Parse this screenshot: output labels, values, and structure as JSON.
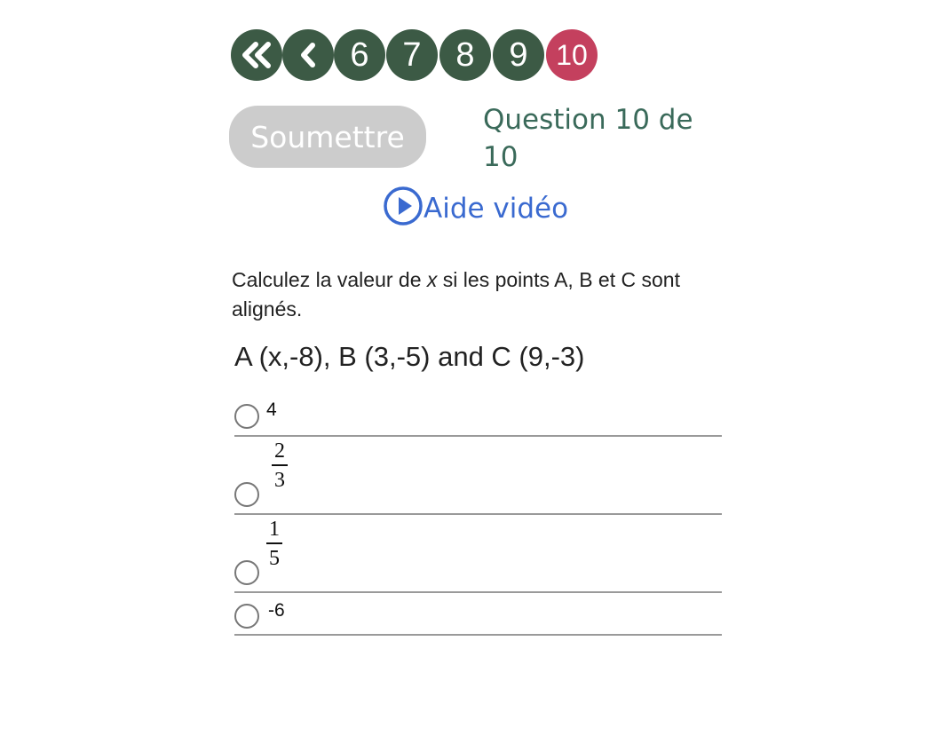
{
  "nav": {
    "first_icon": "double-chevron-left-icon",
    "prev_icon": "chevron-left-icon",
    "pages": [
      "6",
      "7",
      "8",
      "9",
      "10"
    ],
    "current_page": "10",
    "colors": {
      "default": "#3c5a45",
      "current": "#c4405e"
    }
  },
  "submit": {
    "label": "Soumettre"
  },
  "counter": {
    "text": "Question 10 de 10"
  },
  "video_help": {
    "label": "Aide vidéo",
    "icon": "play-circle-icon"
  },
  "question": {
    "prompt_before": "Calculez la valeur de ",
    "variable": "x",
    "prompt_after": " si les points A, B et C sont alignés.",
    "points": "A (x,-8), B (3,-5) and C (9,-3)"
  },
  "options": [
    {
      "value": "4"
    },
    {
      "numerator": "2",
      "denominator": "3"
    },
    {
      "numerator": "1",
      "denominator": "5"
    },
    {
      "value": "-6"
    }
  ]
}
